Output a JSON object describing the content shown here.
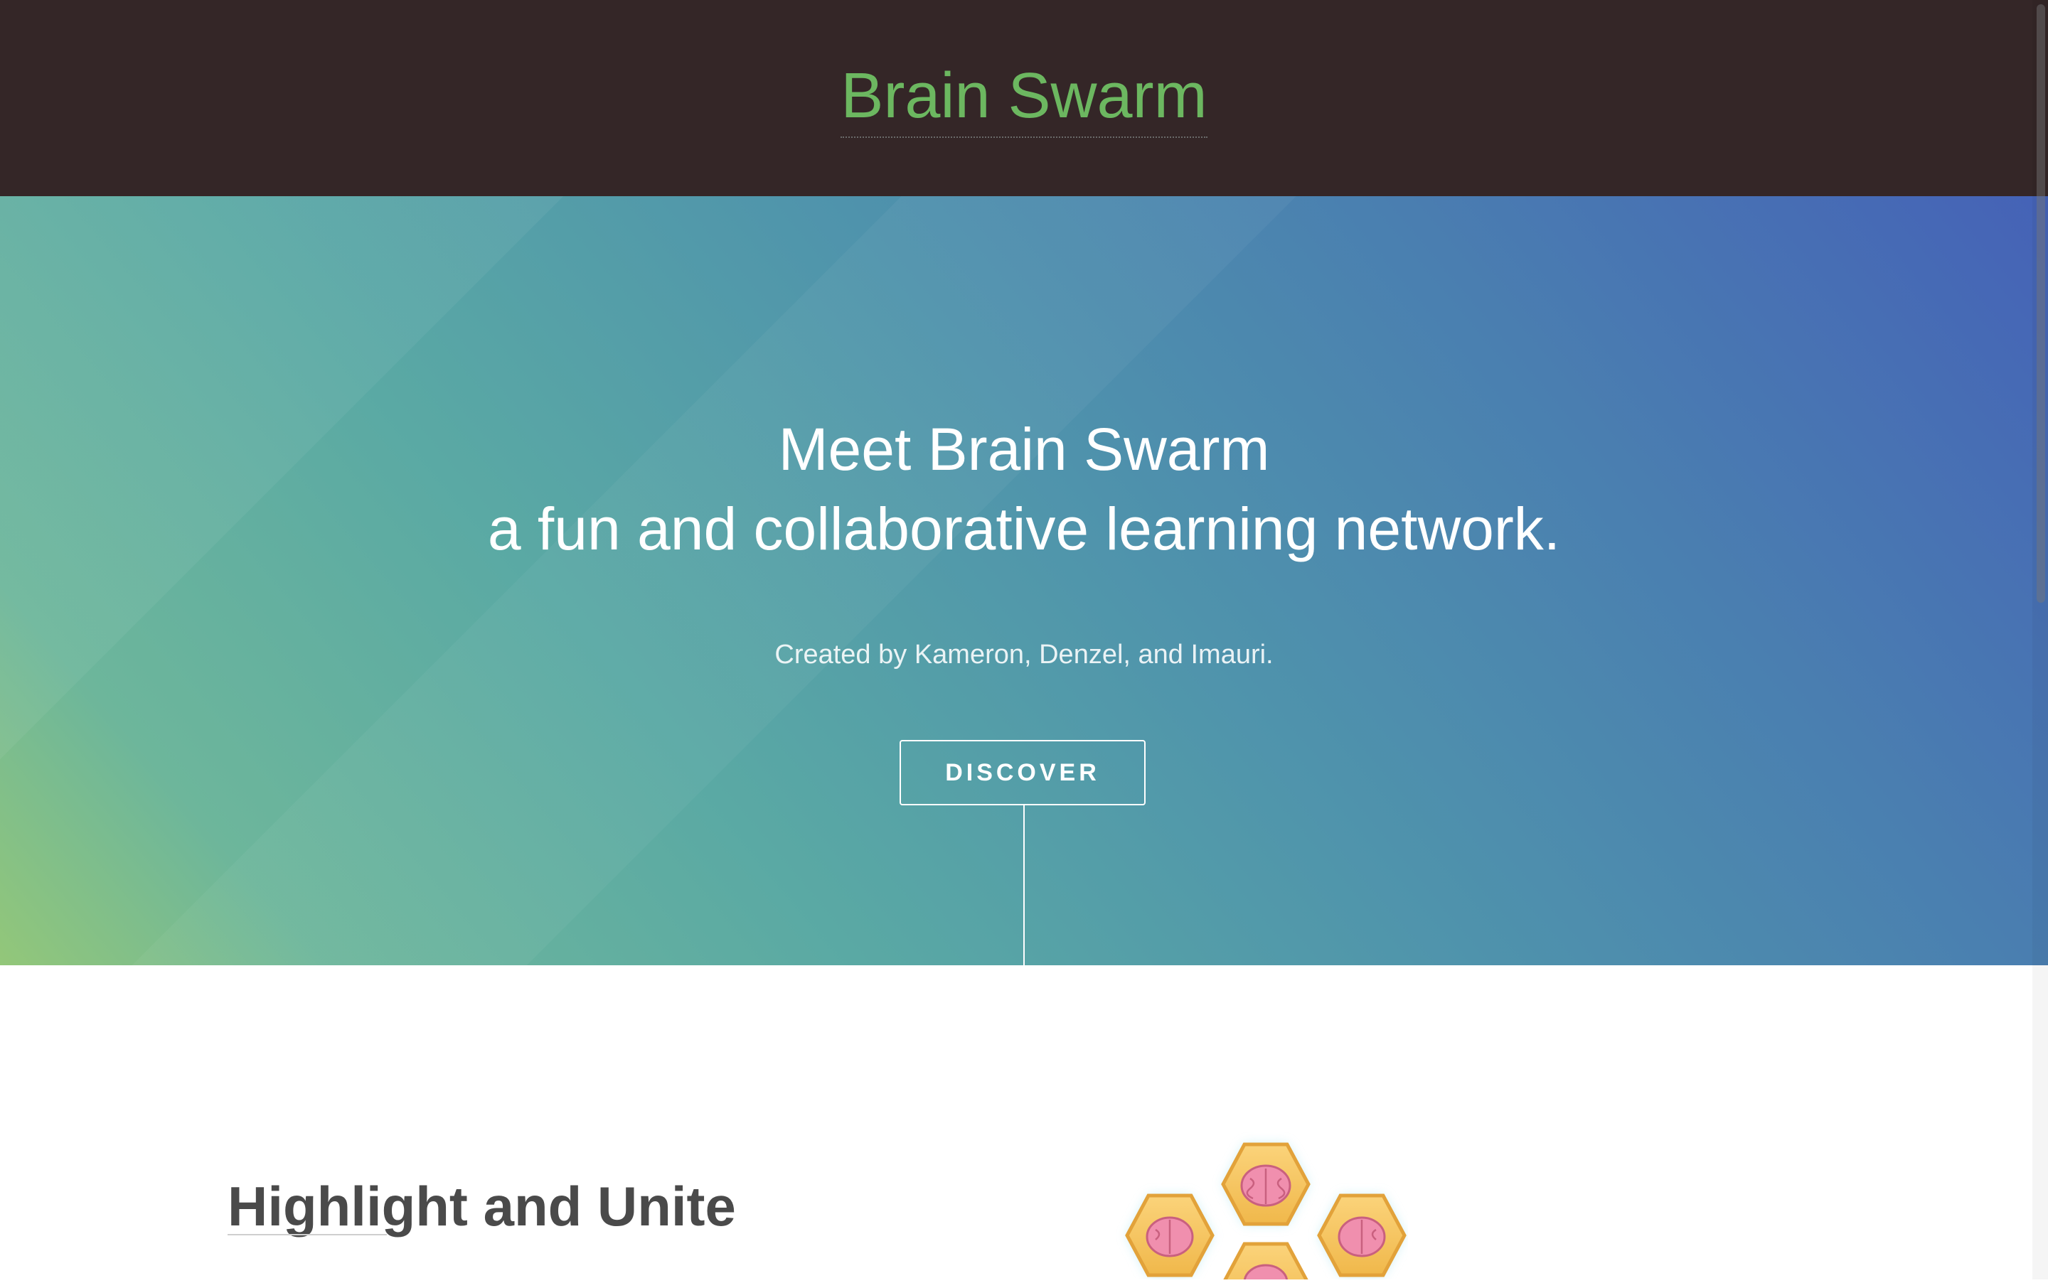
{
  "header": {
    "site_title": "Brain Swarm"
  },
  "hero": {
    "headline_line1": "Meet Brain Swarm",
    "headline_line2": "a fun and collaborative learning network.",
    "credit": "Created by Kameron, Denzel, and Imauri.",
    "discover_label": "DISCOVER"
  },
  "feature": {
    "title": "Highlight and Unite",
    "illustration_icon": "honeycomb-brains-icon"
  },
  "colors": {
    "header_bg": "#342627",
    "brand_green": "#6cb760",
    "hero_gradient_start": "#93c779",
    "hero_gradient_end": "#4562b7"
  }
}
